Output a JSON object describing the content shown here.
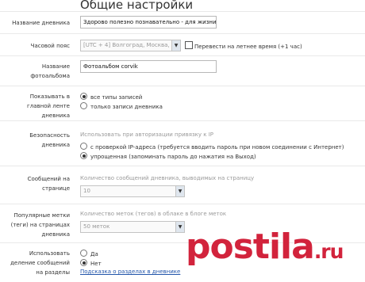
{
  "page_title": "Общие настройки",
  "diary_name": {
    "label": "Название дневника",
    "value": "Здорово полезно познавательно - для жизни"
  },
  "timezone": {
    "label": "Часовой пояс",
    "selected": "[UTC + 4] Волгоград, Москва,",
    "dst_label": "Перевести на летнее время (+1 час)",
    "dst_checked": false
  },
  "album_name": {
    "label_line1": "Название",
    "label_line2": "фотоальбома",
    "value": "Фотоальбом corvik"
  },
  "feed": {
    "label_line1": "Показывать в",
    "label_line2": "главной ленте",
    "label_line3": "дневника",
    "options": [
      {
        "label": "все типы записей",
        "selected": true
      },
      {
        "label": "только записи дневника",
        "selected": false
      }
    ]
  },
  "security": {
    "label_line1": "Безопасность",
    "label_line2": "дневника",
    "hint": "Использовать при авторизации привязку к IP",
    "options": [
      {
        "label": "с проверкой IP-адреса (требуется вводить пароль при новом соединении с Интернет)",
        "selected": false
      },
      {
        "label": "упрощенная (запоминать пароль до нажатия на Выход)",
        "selected": true
      }
    ]
  },
  "posts_per_page": {
    "label_line1": "Сообщений на",
    "label_line2": "странице",
    "hint": "Количество сообщений дневника, выводимых на страницу",
    "selected": "10"
  },
  "popular_tags": {
    "label_line1": "Популярные метки",
    "label_line2": "(теги) на страницах",
    "label_line3": "дневника",
    "hint": "Количество меток (тегов) в облаке в блоге меток",
    "selected": "50 меток"
  },
  "sections": {
    "label_line1": "Использовать",
    "label_line2": "деление сообщений",
    "label_line3": "на разделы",
    "options": [
      {
        "label": "Да",
        "selected": false
      },
      {
        "label": "Нет",
        "selected": true
      }
    ],
    "help_link": "Подсказка о разделах в дневнике"
  },
  "watermark": {
    "main": "postila",
    "suffix": ".ru"
  },
  "colors": {
    "link": "#2255aa",
    "watermark": "#d2233c"
  }
}
